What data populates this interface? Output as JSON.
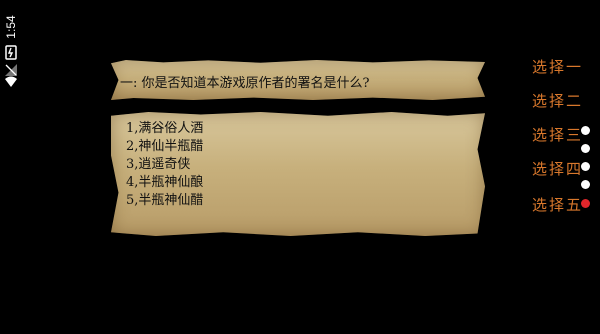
{
  "status": {
    "time": "1:54"
  },
  "question": {
    "text": "一: 你是否知道本游戏原作者的署名是什么?"
  },
  "options": [
    {
      "label": "1,满谷俗人酒"
    },
    {
      "label": "2,神仙半瓶醋"
    },
    {
      "label": "3,逍遥奇侠"
    },
    {
      "label": "4,半瓶神仙酿"
    },
    {
      "label": "5,半瓶神仙醋"
    }
  ],
  "choices": [
    {
      "label": "选择一"
    },
    {
      "label": "选择二"
    },
    {
      "label": "选择三"
    },
    {
      "label": "选择四"
    },
    {
      "label": "选择五"
    }
  ],
  "page_indicator": {
    "total": 5,
    "active": 5,
    "active_color": "#e0262b",
    "inactive_color": "#ffffff"
  },
  "colors": {
    "choice_text": "#d9782c",
    "parchment": "#cdb884"
  }
}
